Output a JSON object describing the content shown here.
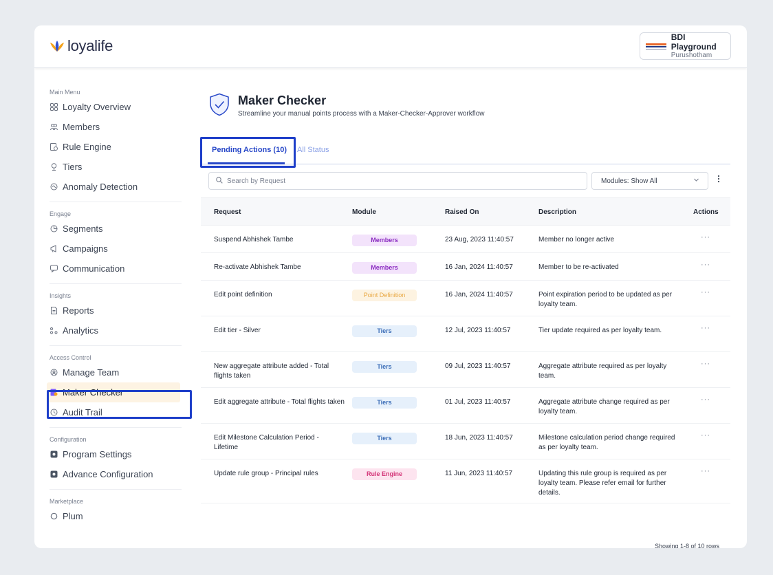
{
  "header": {
    "brand": "loyalife",
    "org_name": "BDI Playground",
    "org_user": "Purushotham"
  },
  "sidebar": {
    "sections": [
      {
        "title": "Main Menu",
        "items": [
          {
            "label": "Loyalty Overview",
            "icon": "dashboard-icon"
          },
          {
            "label": "Members",
            "icon": "members-icon"
          },
          {
            "label": "Rule Engine",
            "icon": "rule-icon"
          },
          {
            "label": "Tiers",
            "icon": "trophy-icon"
          },
          {
            "label": "Anomaly Detection",
            "icon": "anomaly-icon"
          }
        ]
      },
      {
        "title": "Engage",
        "items": [
          {
            "label": "Segments",
            "icon": "segments-icon"
          },
          {
            "label": "Campaigns",
            "icon": "campaign-icon"
          },
          {
            "label": "Communication",
            "icon": "chat-icon"
          }
        ]
      },
      {
        "title": "Insights",
        "items": [
          {
            "label": "Reports",
            "icon": "report-icon"
          },
          {
            "label": "Analytics",
            "icon": "analytics-icon"
          }
        ]
      },
      {
        "title": "Access Control",
        "items": [
          {
            "label": "Manage Team",
            "icon": "team-icon"
          },
          {
            "label": "Maker Checker",
            "icon": "maker-checker-icon"
          },
          {
            "label": "Audit Trail",
            "icon": "audit-icon"
          }
        ]
      },
      {
        "title": "Configuration",
        "items": [
          {
            "label": "Program Settings",
            "icon": "settings-icon"
          },
          {
            "label": "Advance Configuration",
            "icon": "settings-icon"
          }
        ]
      },
      {
        "title": "Marketplace",
        "items": [
          {
            "label": "Plum",
            "icon": "plum-icon"
          }
        ]
      }
    ]
  },
  "page": {
    "title": "Maker Checker",
    "subtitle": "Streamline your manual points process with a Maker-Checker-Approver workflow"
  },
  "tabs": {
    "pending": "Pending Actions (10)",
    "all": "All Status"
  },
  "filters": {
    "search_placeholder": "Search by Request",
    "modules_label": "Modules: Show All"
  },
  "table": {
    "headers": {
      "request": "Request",
      "module": "Module",
      "raised_on": "Raised On",
      "description": "Description",
      "actions": "Actions"
    },
    "rows": [
      {
        "request": "Suspend Abhishek Tambe",
        "module": "Members",
        "raised_on": "23 Aug, 2023 11:40:57",
        "description": "Member no longer active",
        "action": "···"
      },
      {
        "request": "Re-activate Abhishek Tambe",
        "module": "Members",
        "raised_on": "16 Jan, 2024 11:40:57",
        "description": "Member to be re-activated",
        "action": "···"
      },
      {
        "request": "Edit point definition",
        "module": "Point Definition",
        "raised_on": "16 Jan, 2024 11:40:57",
        "description": "Point expiration period to be updated as per loyalty team.",
        "action": "···"
      },
      {
        "request": "Edit tier - Silver",
        "module": "Tiers",
        "raised_on": "12 Jul, 2023 11:40:57",
        "description": "Tier update required as per loyalty team.",
        "action": "···"
      },
      {
        "request": "New aggregate attribute added - Total flights taken",
        "module": "Tiers",
        "raised_on": "09 Jul, 2023 11:40:57",
        "description": "Aggregate attribute required as per loyalty team.",
        "action": "···"
      },
      {
        "request": "Edit aggregate attribute - Total flights taken",
        "module": "Tiers",
        "raised_on": "01 Jul, 2023 11:40:57",
        "description": "Aggregate attribute change required as per loyalty team.",
        "action": "···"
      },
      {
        "request": "Edit Milestone Calculation Period - Lifetime",
        "module": "Tiers",
        "raised_on": "18 Jun, 2023 11:40:57",
        "description": "Milestone calculation period change required as per loyalty team.",
        "action": "···"
      },
      {
        "request": "Update rule group - Principal rules",
        "module": "Rule Engine",
        "raised_on": "11 Jun, 2023 11:40:57",
        "description": "Updating this rule group is required as per loyalty team. Please refer email for further details.",
        "action": "···"
      }
    ],
    "footer": "Showing 1-8 of 10 rows"
  },
  "colors": {
    "accent": "#2848c8",
    "highlight_box": "#1e3fc9",
    "active_nav_bg": "#fdf3e3"
  }
}
